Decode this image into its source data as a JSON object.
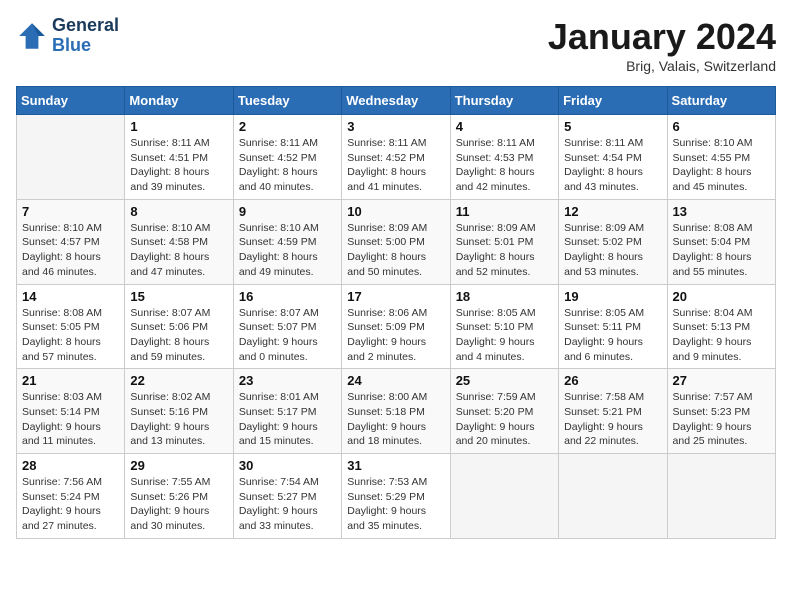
{
  "header": {
    "logo_line1": "General",
    "logo_line2": "Blue",
    "title": "January 2024",
    "subtitle": "Brig, Valais, Switzerland"
  },
  "weekdays": [
    "Sunday",
    "Monday",
    "Tuesday",
    "Wednesday",
    "Thursday",
    "Friday",
    "Saturday"
  ],
  "weeks": [
    [
      {
        "day": "",
        "info": ""
      },
      {
        "day": "1",
        "info": "Sunrise: 8:11 AM\nSunset: 4:51 PM\nDaylight: 8 hours\nand 39 minutes."
      },
      {
        "day": "2",
        "info": "Sunrise: 8:11 AM\nSunset: 4:52 PM\nDaylight: 8 hours\nand 40 minutes."
      },
      {
        "day": "3",
        "info": "Sunrise: 8:11 AM\nSunset: 4:52 PM\nDaylight: 8 hours\nand 41 minutes."
      },
      {
        "day": "4",
        "info": "Sunrise: 8:11 AM\nSunset: 4:53 PM\nDaylight: 8 hours\nand 42 minutes."
      },
      {
        "day": "5",
        "info": "Sunrise: 8:11 AM\nSunset: 4:54 PM\nDaylight: 8 hours\nand 43 minutes."
      },
      {
        "day": "6",
        "info": "Sunrise: 8:10 AM\nSunset: 4:55 PM\nDaylight: 8 hours\nand 45 minutes."
      }
    ],
    [
      {
        "day": "7",
        "info": "Sunrise: 8:10 AM\nSunset: 4:57 PM\nDaylight: 8 hours\nand 46 minutes."
      },
      {
        "day": "8",
        "info": "Sunrise: 8:10 AM\nSunset: 4:58 PM\nDaylight: 8 hours\nand 47 minutes."
      },
      {
        "day": "9",
        "info": "Sunrise: 8:10 AM\nSunset: 4:59 PM\nDaylight: 8 hours\nand 49 minutes."
      },
      {
        "day": "10",
        "info": "Sunrise: 8:09 AM\nSunset: 5:00 PM\nDaylight: 8 hours\nand 50 minutes."
      },
      {
        "day": "11",
        "info": "Sunrise: 8:09 AM\nSunset: 5:01 PM\nDaylight: 8 hours\nand 52 minutes."
      },
      {
        "day": "12",
        "info": "Sunrise: 8:09 AM\nSunset: 5:02 PM\nDaylight: 8 hours\nand 53 minutes."
      },
      {
        "day": "13",
        "info": "Sunrise: 8:08 AM\nSunset: 5:04 PM\nDaylight: 8 hours\nand 55 minutes."
      }
    ],
    [
      {
        "day": "14",
        "info": "Sunrise: 8:08 AM\nSunset: 5:05 PM\nDaylight: 8 hours\nand 57 minutes."
      },
      {
        "day": "15",
        "info": "Sunrise: 8:07 AM\nSunset: 5:06 PM\nDaylight: 8 hours\nand 59 minutes."
      },
      {
        "day": "16",
        "info": "Sunrise: 8:07 AM\nSunset: 5:07 PM\nDaylight: 9 hours\nand 0 minutes."
      },
      {
        "day": "17",
        "info": "Sunrise: 8:06 AM\nSunset: 5:09 PM\nDaylight: 9 hours\nand 2 minutes."
      },
      {
        "day": "18",
        "info": "Sunrise: 8:05 AM\nSunset: 5:10 PM\nDaylight: 9 hours\nand 4 minutes."
      },
      {
        "day": "19",
        "info": "Sunrise: 8:05 AM\nSunset: 5:11 PM\nDaylight: 9 hours\nand 6 minutes."
      },
      {
        "day": "20",
        "info": "Sunrise: 8:04 AM\nSunset: 5:13 PM\nDaylight: 9 hours\nand 9 minutes."
      }
    ],
    [
      {
        "day": "21",
        "info": "Sunrise: 8:03 AM\nSunset: 5:14 PM\nDaylight: 9 hours\nand 11 minutes."
      },
      {
        "day": "22",
        "info": "Sunrise: 8:02 AM\nSunset: 5:16 PM\nDaylight: 9 hours\nand 13 minutes."
      },
      {
        "day": "23",
        "info": "Sunrise: 8:01 AM\nSunset: 5:17 PM\nDaylight: 9 hours\nand 15 minutes."
      },
      {
        "day": "24",
        "info": "Sunrise: 8:00 AM\nSunset: 5:18 PM\nDaylight: 9 hours\nand 18 minutes."
      },
      {
        "day": "25",
        "info": "Sunrise: 7:59 AM\nSunset: 5:20 PM\nDaylight: 9 hours\nand 20 minutes."
      },
      {
        "day": "26",
        "info": "Sunrise: 7:58 AM\nSunset: 5:21 PM\nDaylight: 9 hours\nand 22 minutes."
      },
      {
        "day": "27",
        "info": "Sunrise: 7:57 AM\nSunset: 5:23 PM\nDaylight: 9 hours\nand 25 minutes."
      }
    ],
    [
      {
        "day": "28",
        "info": "Sunrise: 7:56 AM\nSunset: 5:24 PM\nDaylight: 9 hours\nand 27 minutes."
      },
      {
        "day": "29",
        "info": "Sunrise: 7:55 AM\nSunset: 5:26 PM\nDaylight: 9 hours\nand 30 minutes."
      },
      {
        "day": "30",
        "info": "Sunrise: 7:54 AM\nSunset: 5:27 PM\nDaylight: 9 hours\nand 33 minutes."
      },
      {
        "day": "31",
        "info": "Sunrise: 7:53 AM\nSunset: 5:29 PM\nDaylight: 9 hours\nand 35 minutes."
      },
      {
        "day": "",
        "info": ""
      },
      {
        "day": "",
        "info": ""
      },
      {
        "day": "",
        "info": ""
      }
    ]
  ]
}
